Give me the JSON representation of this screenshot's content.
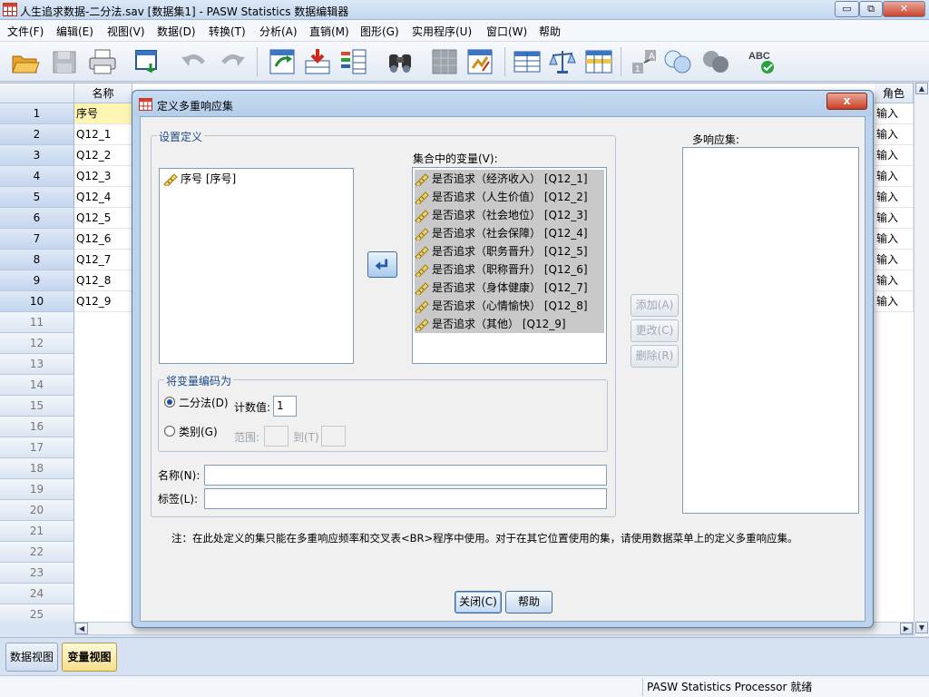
{
  "window": {
    "title": "人生追求数据-二分法.sav [数据集1] - PASW Statistics 数据编辑器",
    "min_label": "▭",
    "max_label": "⧉",
    "close_label": "✕"
  },
  "menu": {
    "items": [
      "文件(F)",
      "编辑(E)",
      "视图(V)",
      "数据(D)",
      "转换(T)",
      "分析(A)",
      "直销(M)",
      "图形(G)",
      "实用程序(U)",
      "窗口(W)",
      "帮助"
    ]
  },
  "toolbar": {
    "icons": [
      "open-icon",
      "save-icon",
      "print-icon",
      "dialog-recall-icon",
      "undo-icon",
      "redo-icon",
      "goto-case-icon",
      "goto-variable-icon",
      "variables-icon",
      "find-icon",
      "insert-cases-icon",
      "insert-variable-icon",
      "split-file-icon",
      "weight-cases-icon",
      "select-cases-icon",
      "value-labels-icon",
      "use-sets-icon",
      "show-all-icon",
      "spell-check-icon"
    ],
    "spell_label": "ABC"
  },
  "grid": {
    "col_name": "名称",
    "col_role": "角色",
    "rows": [
      "1",
      "2",
      "3",
      "4",
      "5",
      "6",
      "7",
      "8",
      "9",
      "10",
      "11",
      "12",
      "13",
      "14",
      "15",
      "16",
      "17",
      "18",
      "19",
      "20",
      "21",
      "22",
      "23",
      "24",
      "25"
    ],
    "names": [
      "序号",
      "Q12_1",
      "Q12_2",
      "Q12_3",
      "Q12_4",
      "Q12_5",
      "Q12_6",
      "Q12_7",
      "Q12_8",
      "Q12_9"
    ],
    "roles": [
      "输入",
      "输入",
      "输入",
      "输入",
      "输入",
      "输入",
      "输入",
      "输入",
      "输入",
      "输入"
    ]
  },
  "view_tabs": {
    "data_view": "数据视图",
    "variable_view": "变量视图",
    "active": "variable_view"
  },
  "status": {
    "text": "PASW Statistics Processor 就绪"
  },
  "dialog": {
    "title": "定义多重响应集",
    "close_label": "x",
    "set_definition_label": "设置定义",
    "source_variables": [
      "序号 [序号]"
    ],
    "vars_in_set_label": "集合中的变量(V):",
    "vars_in_set": [
      "是否追求（经济收入） [Q12_1]",
      "是否追求（人生价值） [Q12_2]",
      "是否追求（社会地位） [Q12_3]",
      "是否追求（社会保障） [Q12_4]",
      "是否追求（职务晋升） [Q12_5]",
      "是否追求（职称晋升） [Q12_6]",
      "是否追求（身体健康） [Q12_7]",
      "是否追求（心情愉快） [Q12_8]",
      "是否追求（其他） [Q12_9]"
    ],
    "encode_as_label": "将变量编码为",
    "dichotomies_label": "二分法(D)",
    "counted_value_label": "计数值:",
    "counted_value": "1",
    "categories_label": "类别(G)",
    "range_label": "范围:",
    "through_label": "到(T)",
    "name_label": "名称(N):",
    "name_value": "",
    "label_label": "标签(L):",
    "label_value": "",
    "mr_sets_label": "多响应集:",
    "mr_sets": [],
    "add_label": "添加(A)",
    "change_label": "更改(C)",
    "remove_label": "删除(R)",
    "note": "注：在此处定义的集只能在多重响应频率和交叉表<BR>程序中使用。对于在其它位置使用的集，请使用数据菜单上的定义多重响应集。",
    "close_button": "关闭(C)",
    "help_button": "帮助",
    "encoding_selected": "dichotomies"
  }
}
